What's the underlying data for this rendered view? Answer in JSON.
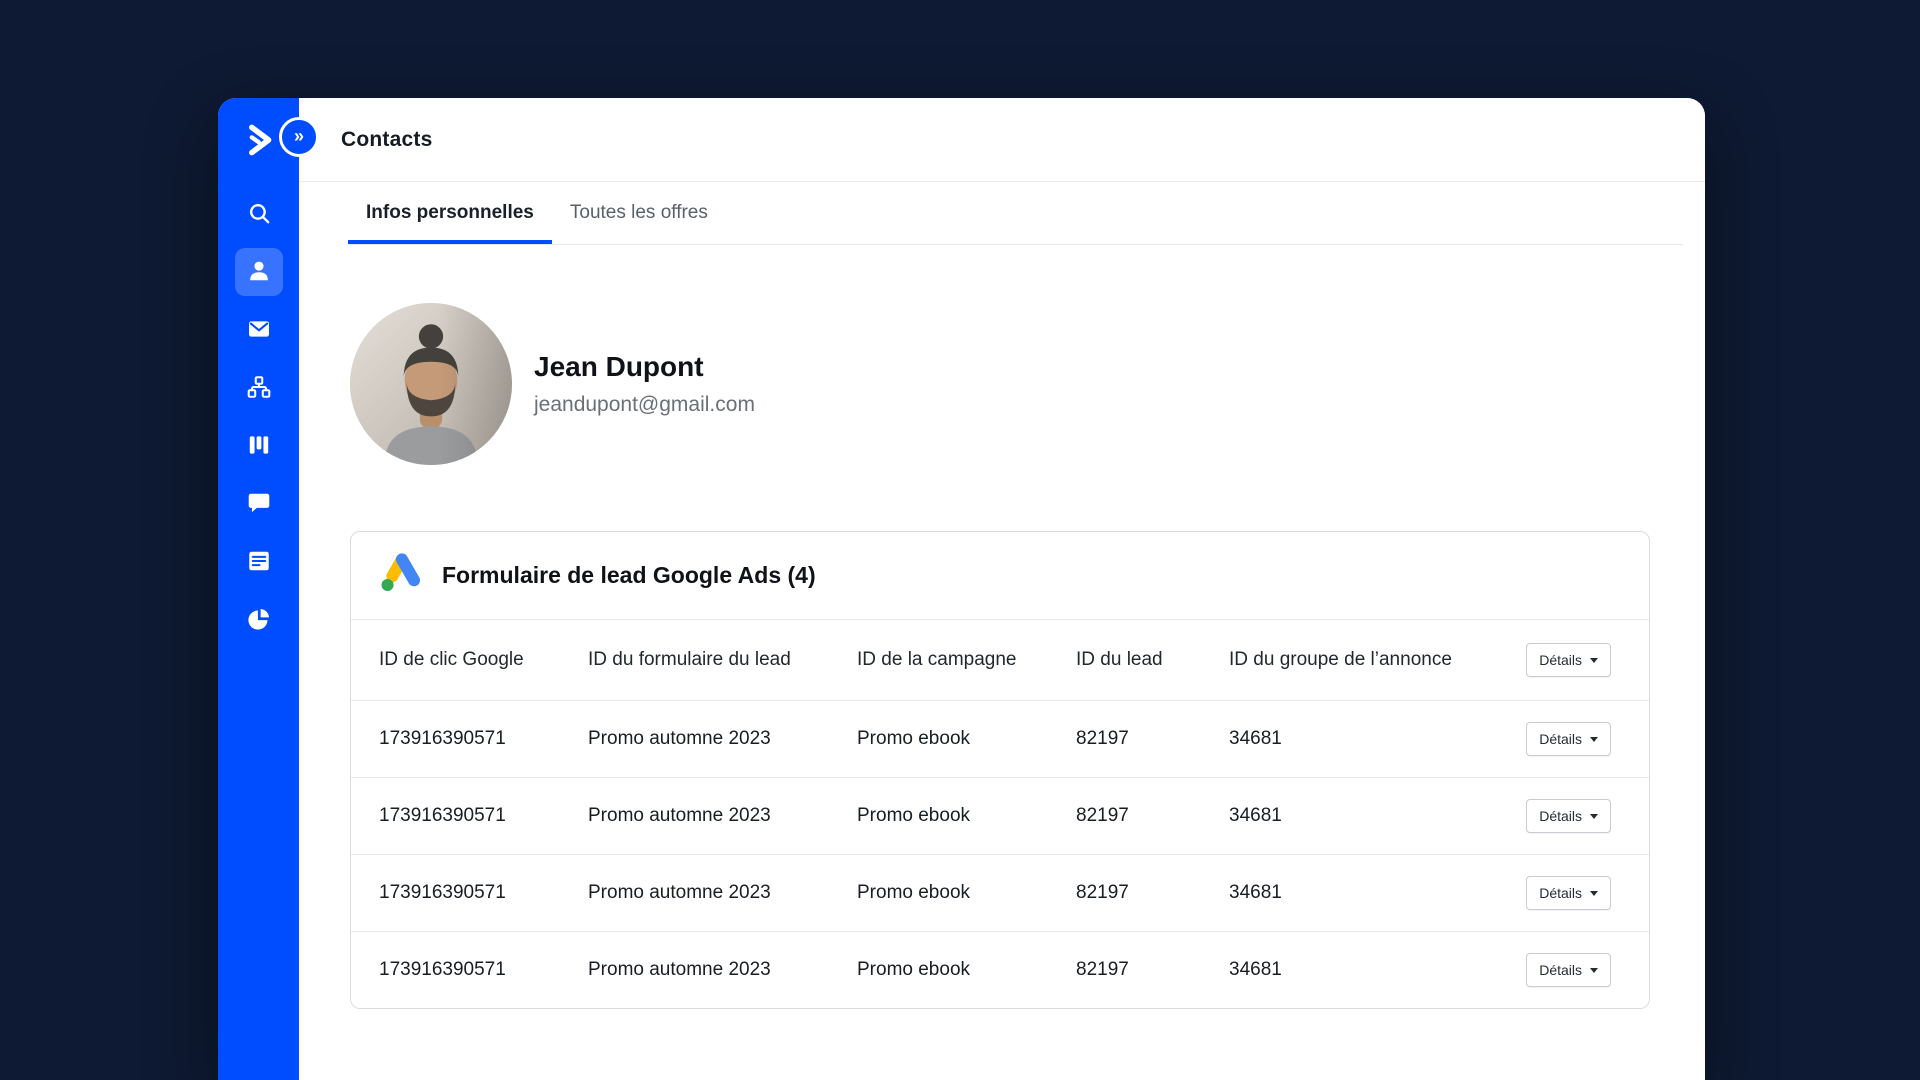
{
  "page": {
    "title": "Contacts"
  },
  "sidebar": {
    "expand_glyph": "»",
    "items": [
      {
        "icon": "search-icon",
        "active": false
      },
      {
        "icon": "contacts-icon",
        "active": true
      },
      {
        "icon": "mail-icon",
        "active": false
      },
      {
        "icon": "sitemap-icon",
        "active": false
      },
      {
        "icon": "kanban-icon",
        "active": false
      },
      {
        "icon": "chat-icon",
        "active": false
      },
      {
        "icon": "form-icon",
        "active": false
      },
      {
        "icon": "pie-chart-icon",
        "active": false
      }
    ]
  },
  "tabs": [
    {
      "label": "Infos personnelles",
      "active": true
    },
    {
      "label": "Toutes les offres",
      "active": false
    }
  ],
  "contact": {
    "name": "Jean Dupont",
    "email": "jeandupont@gmail.com"
  },
  "lead_card": {
    "title": "Formulaire de lead Google Ads (4)",
    "columns": [
      "ID de clic Google",
      "ID du formulaire du lead",
      "ID de la campagne",
      "ID du lead",
      "ID du groupe de l’annonce"
    ],
    "details_button": {
      "label": "Détails"
    },
    "rows": [
      [
        "173916390571",
        "Promo automne 2023",
        "Promo ebook",
        "82197",
        "34681"
      ],
      [
        "173916390571",
        "Promo automne 2023",
        "Promo ebook",
        "82197",
        "34681"
      ],
      [
        "173916390571",
        "Promo automne 2023",
        "Promo ebook",
        "82197",
        "34681"
      ],
      [
        "173916390571",
        "Promo automne 2023",
        "Promo ebook",
        "82197",
        "34681"
      ]
    ]
  },
  "colors": {
    "accent": "#004CFF",
    "background": "#0E1A33",
    "google_blue": "#4285F4",
    "google_yellow": "#FBBC04",
    "google_green": "#34A853"
  }
}
